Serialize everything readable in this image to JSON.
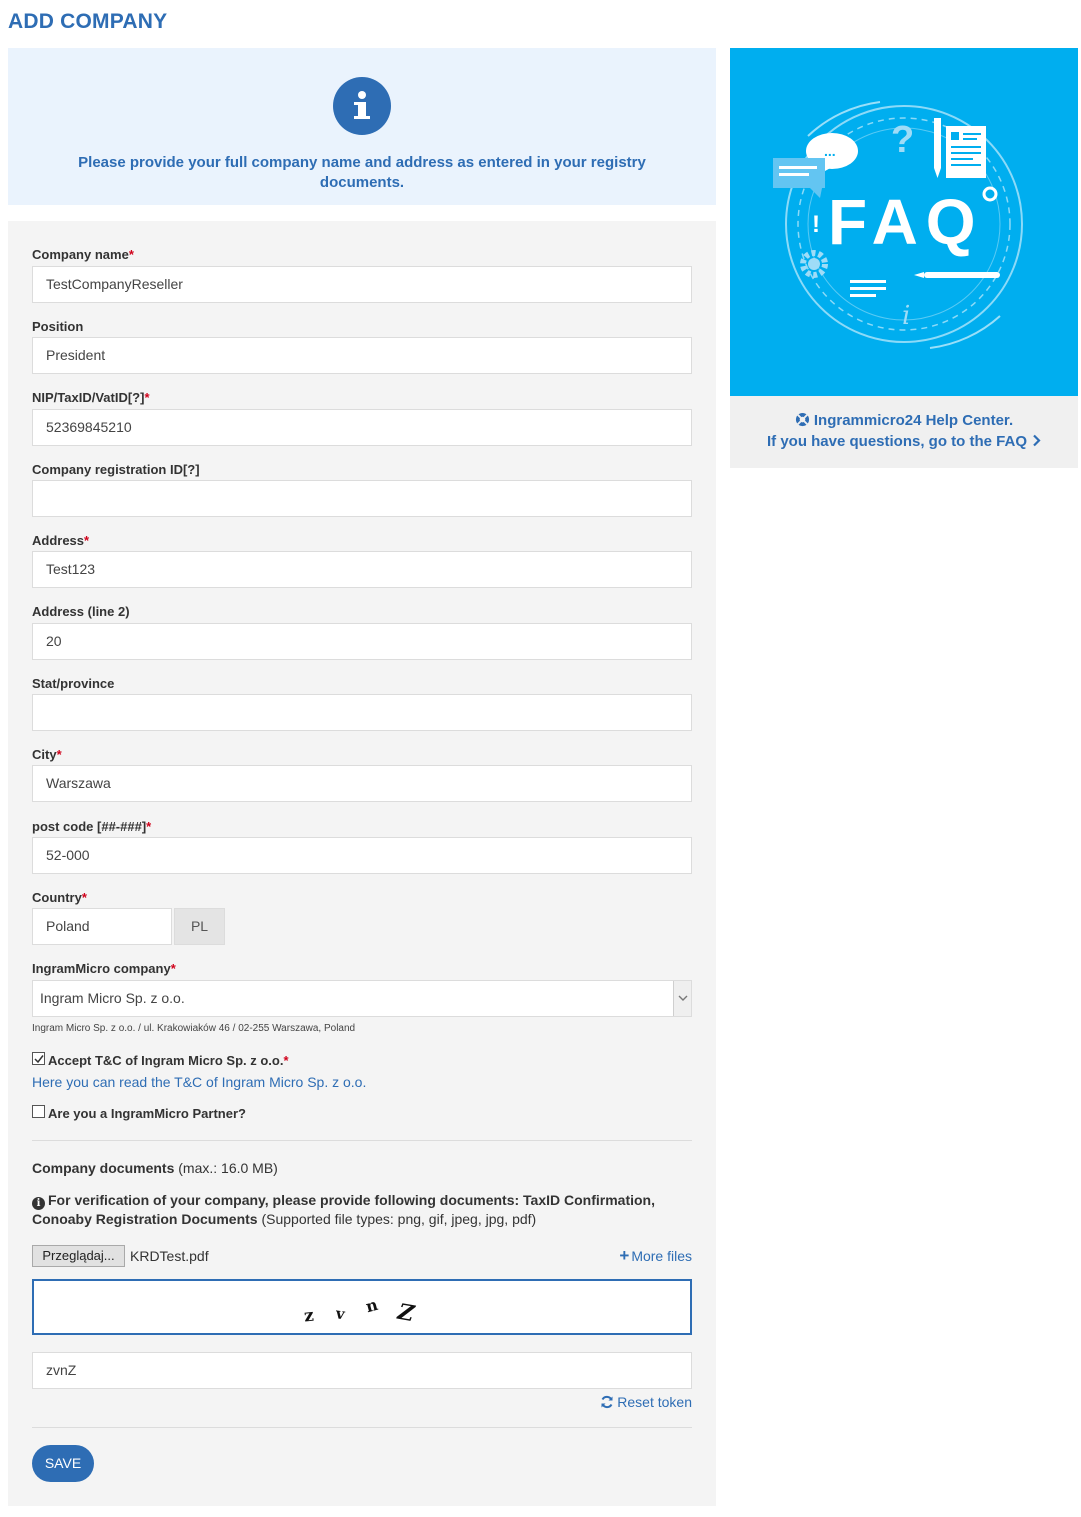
{
  "page": {
    "title": "ADD COMPANY"
  },
  "info": {
    "message": "Please provide your full company name and address as entered in your registry documents."
  },
  "form": {
    "company_name": {
      "label": "Company name",
      "required_mark": "*",
      "value": "TestCompanyReseller"
    },
    "position": {
      "label": "Position",
      "value": "President"
    },
    "tax_id": {
      "label": "NIP/TaxID/VatID[?]",
      "required_mark": "*",
      "value": "52369845210"
    },
    "registration_id": {
      "label": "Company registration ID[?]",
      "value": ""
    },
    "address": {
      "label": "Address",
      "required_mark": "*",
      "value": "Test123"
    },
    "address2": {
      "label": "Address (line 2)",
      "value": "20"
    },
    "state": {
      "label": "Stat/province",
      "value": ""
    },
    "city": {
      "label": "City",
      "required_mark": "*",
      "value": "Warszawa"
    },
    "post_code": {
      "label": "post code [##-###]",
      "required_mark": "*",
      "value": "52-000"
    },
    "country": {
      "label": "Country",
      "required_mark": "*",
      "value": "Poland",
      "code": "PL"
    },
    "ingram_company": {
      "label": "IngramMicro company",
      "required_mark": "*",
      "selected": "Ingram Micro Sp. z o.o.",
      "address": "Ingram Micro Sp. z o.o. / ul. Krakowiaków 46 / 02-255 Warszawa, Poland"
    },
    "accept_tc": {
      "label": "Accept T&C of Ingram Micro Sp. z o.o.",
      "required_mark": "*",
      "checked": true
    },
    "tc_link": "Here you can read the T&C of Ingram Micro Sp. z o.o.",
    "partner": {
      "label": "Are you a IngramMicro Partner?",
      "checked": false
    },
    "documents": {
      "title": "Company documents",
      "max_size": "(max.: 16.0 MB)",
      "info_bold": "For verification of your company, please provide following documents: TaxID Confirmation, Conoaby Registration Documents",
      "info_types": "(Supported file types: png, gif, jpeg, jpg, pdf)",
      "browse_label": "Przeglądaj...",
      "file_name": "KRDTest.pdf",
      "more_files": "More files"
    },
    "captcha": {
      "chars": [
        "z",
        "v",
        "n",
        "Z"
      ],
      "value": "zvnZ",
      "reset_label": "Reset token"
    },
    "save_label": "SAVE"
  },
  "faq": {
    "banner_text": "FAQ",
    "help_center": "Ingrammicro24 Help Center.",
    "help_questions": "If you have questions, go to the FAQ",
    "bubble_text": "..."
  },
  "colors": {
    "accent": "#2e6db4",
    "required": "#d0021b",
    "faq_bg": "#00aeef",
    "info_bg": "#eaf3fd",
    "panel_bg": "#f4f4f4"
  },
  "icons": [
    "info-icon",
    "check-icon",
    "plus-icon",
    "refresh-icon",
    "lifebuoy-icon",
    "chevron-right-icon",
    "select-arrow-icon"
  ]
}
